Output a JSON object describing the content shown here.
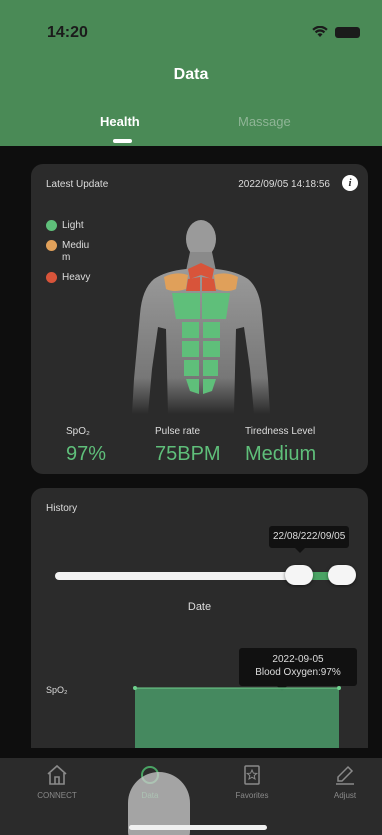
{
  "status_bar": {
    "time": "14:20"
  },
  "header": {
    "title": "Data",
    "tabs": [
      {
        "label": "Health",
        "active": true
      },
      {
        "label": "Massage",
        "active": false
      }
    ]
  },
  "latest": {
    "label": "Latest Update",
    "timestamp": "2022/09/05 14:18:56",
    "info_icon": "info-icon",
    "legend": [
      {
        "label": "Light",
        "color": "#5fbf7a"
      },
      {
        "label": "Mediu m",
        "color": "#e0a05a"
      },
      {
        "label": "Heavy",
        "color": "#d8543a"
      }
    ],
    "metrics": [
      {
        "label": "SpO₂",
        "value": "97%"
      },
      {
        "label": "Pulse rate",
        "value": "75BPM"
      },
      {
        "label": "Tiredness Level",
        "value": "Medium"
      }
    ]
  },
  "history": {
    "label": "History",
    "range_tooltip": "22/08/222/09/05",
    "slider_label": "Date",
    "chart_tooltip_date": "2022-09-05",
    "chart_tooltip_value": "Blood Oxygen:97%",
    "axis_label": "SpO₂",
    "accent": "#4aa364"
  },
  "tabbar": {
    "items": [
      {
        "label": "CONNECT",
        "icon": "home-icon",
        "active": false
      },
      {
        "label": "Data",
        "icon": "data-icon",
        "active": true
      },
      {
        "label": "Favorites",
        "icon": "star-icon",
        "active": false
      },
      {
        "label": "Adjust",
        "icon": "adjust-icon",
        "active": false
      }
    ]
  }
}
